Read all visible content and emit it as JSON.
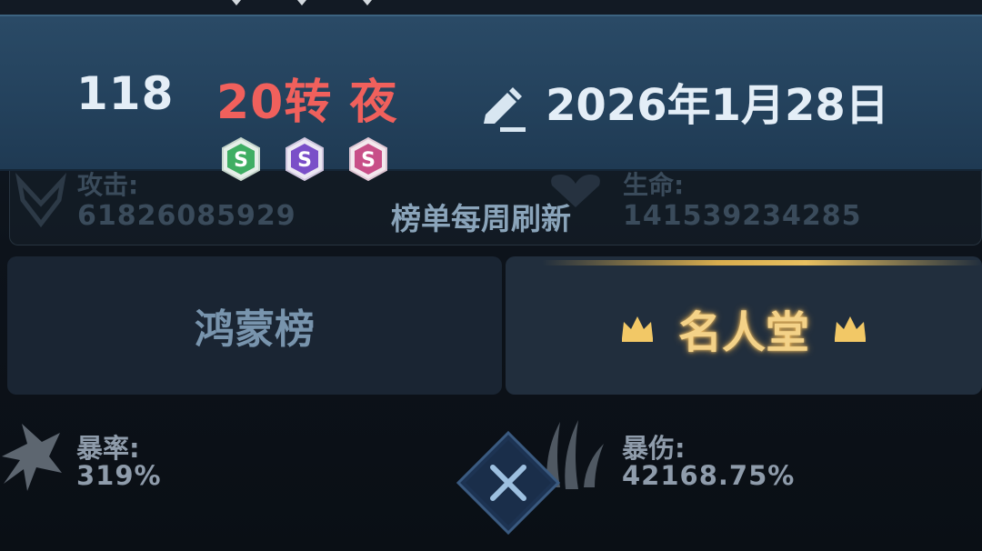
{
  "header": {
    "rank": "118",
    "player_name": "20转 夜",
    "date": "2026年1月28日",
    "badges": [
      {
        "icon": "s-rank-badge-icon",
        "color": "#3fae63"
      },
      {
        "icon": "s-rank-badge-icon",
        "color": "#7a4fc8"
      },
      {
        "icon": "s-rank-badge-icon",
        "color": "#c84f88"
      }
    ]
  },
  "background_stats": {
    "attack_label": "攻击:",
    "attack_value": "61826085929",
    "hp_label": "生命:",
    "hp_value": "141539234285"
  },
  "notice": "榜单每周刷新",
  "tabs": {
    "left_label": "鸿蒙榜",
    "right_label": "名人堂"
  },
  "stats": {
    "crit_rate_label": "暴率:",
    "crit_rate_value": "319%",
    "crit_damage_label": "暴伤:",
    "crit_damage_value": "42168.75%"
  },
  "colors": {
    "accent_gold": "#f4d288",
    "name_red": "#f0605c",
    "banner_blue": "#24425d"
  }
}
